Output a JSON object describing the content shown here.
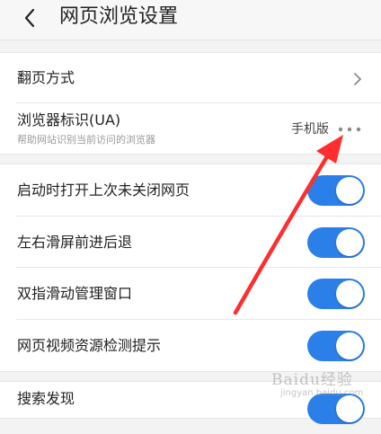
{
  "header": {
    "title": "网页浏览设置"
  },
  "settings": {
    "page_turn": {
      "label": "翻页方式"
    },
    "ua": {
      "label": "浏览器标识(UA)",
      "description": "帮助网站识别当前访问的浏览器",
      "value": "手机版"
    },
    "toggles": [
      {
        "label": "启动时打开上次未关闭网页",
        "enabled": true
      },
      {
        "label": "左右滑屏前进后退",
        "enabled": true
      },
      {
        "label": "双指滑动管理窗口",
        "enabled": true
      },
      {
        "label": "网页视频资源检测提示",
        "enabled": true
      },
      {
        "label": "搜索发现",
        "enabled": true
      }
    ]
  },
  "watermark": {
    "logo": "Baidu经验",
    "sub": "jingyan.baidu.com"
  },
  "colors": {
    "toggle_on": "#2a80e8",
    "annotation_arrow": "#ff2e2e"
  },
  "icons": [
    "chevron-left-icon",
    "chevron-right-icon",
    "more-dots-icon"
  ]
}
